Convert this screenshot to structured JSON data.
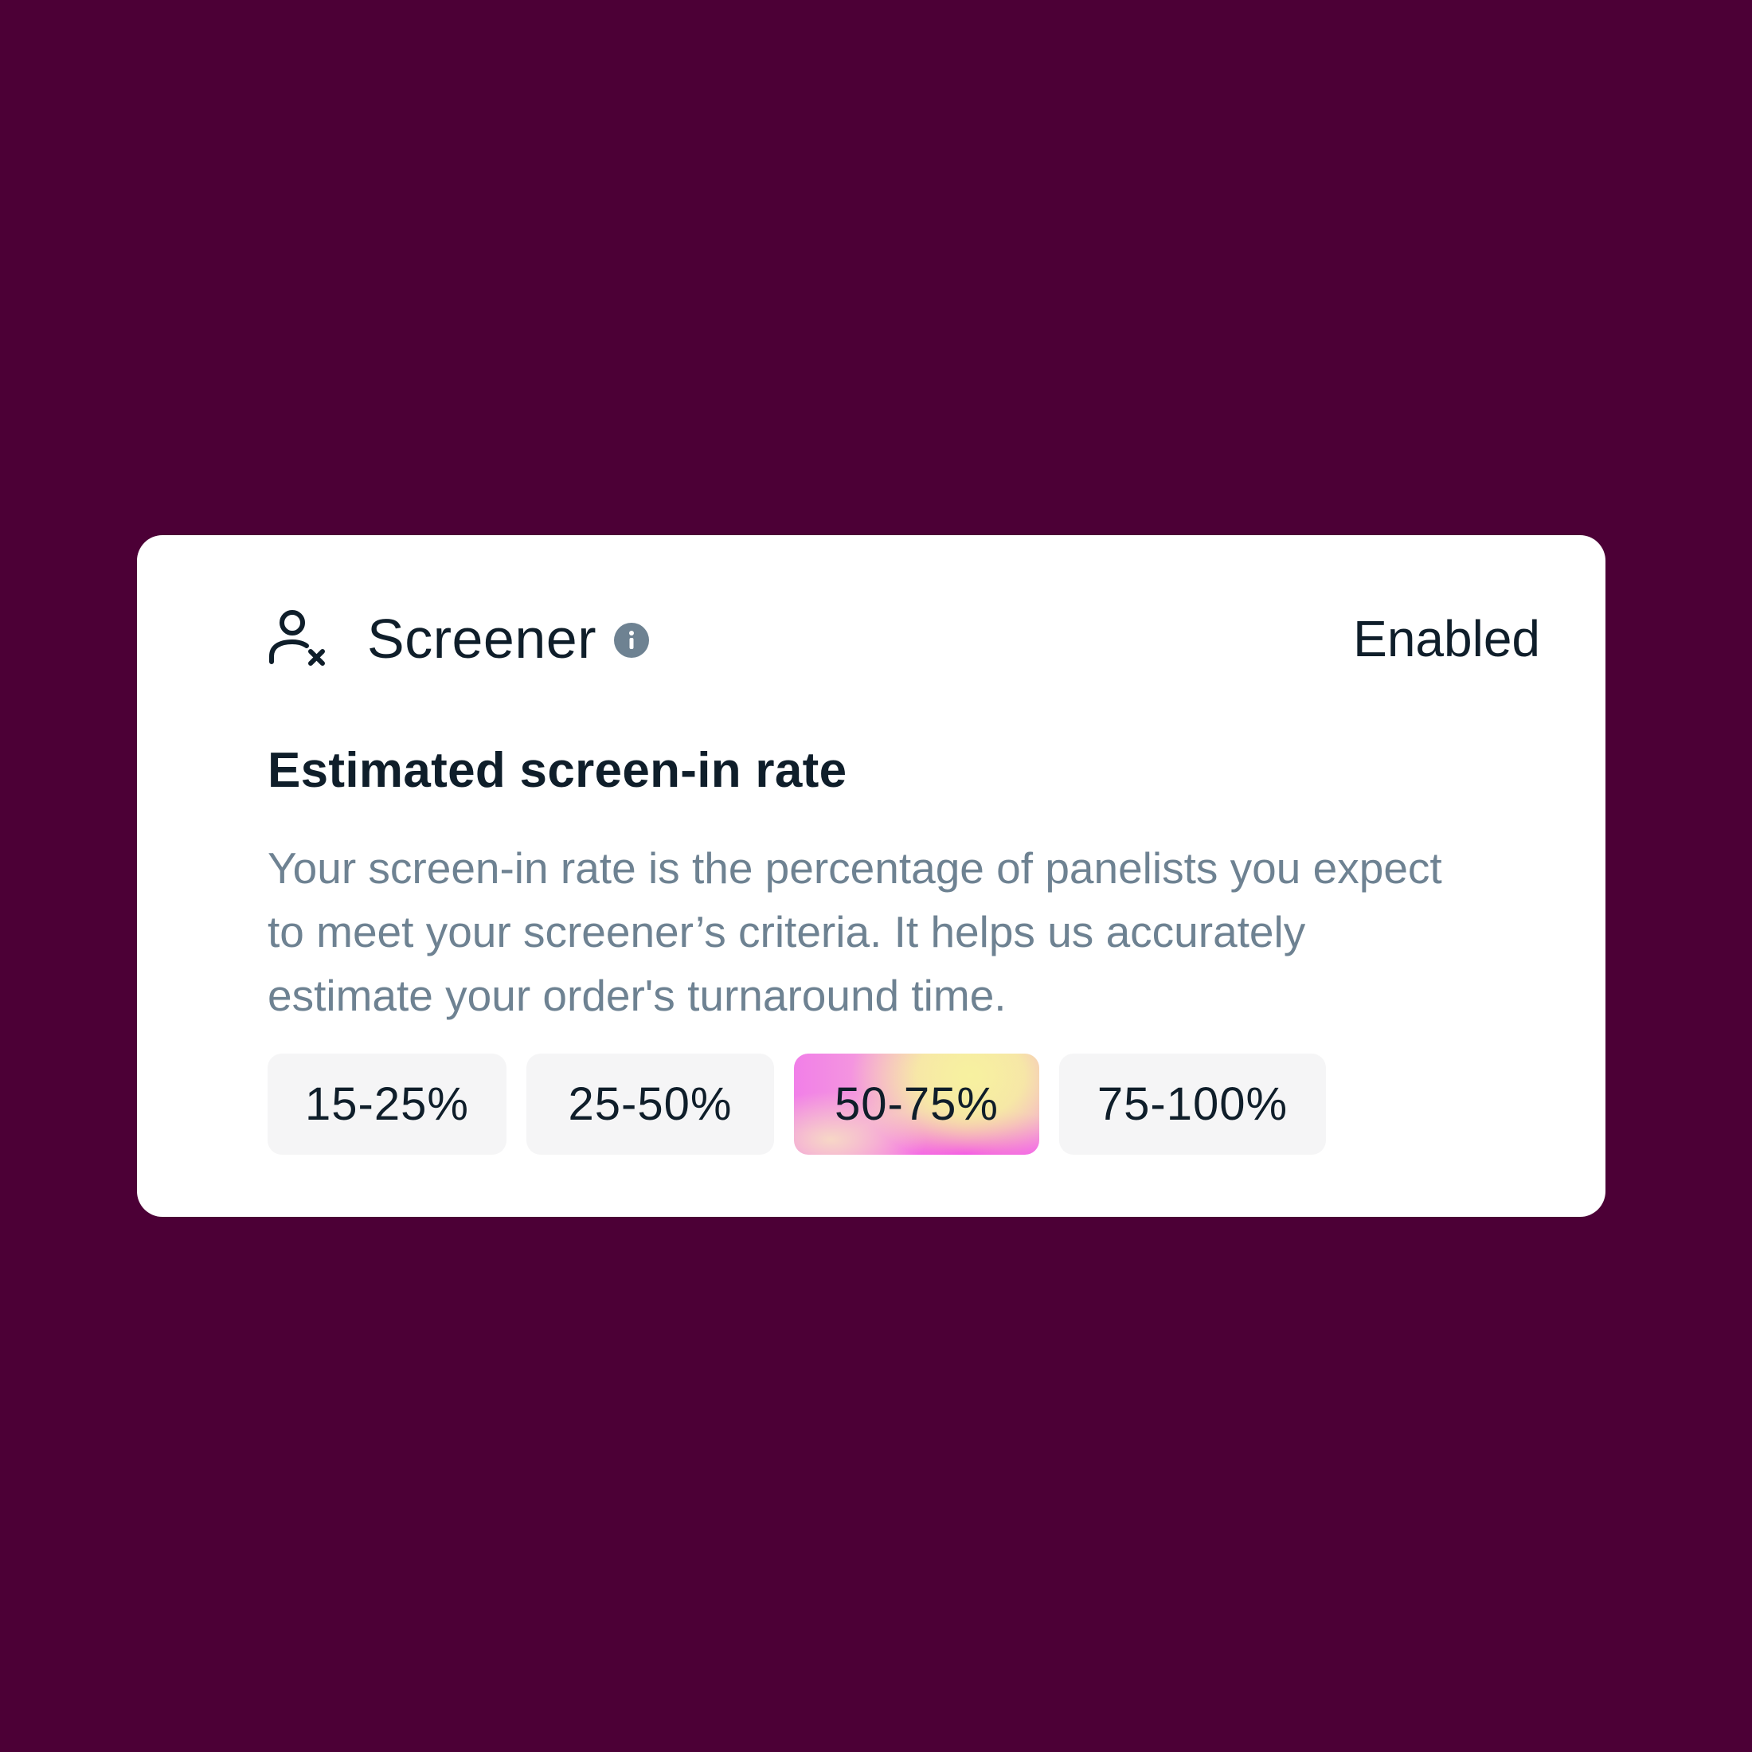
{
  "card": {
    "title": "Screener",
    "status": "Enabled",
    "icons": {
      "header": "user-x-icon",
      "info": "info-icon"
    },
    "subheading": "Estimated screen-in rate",
    "description": "Your screen-in rate is the percentage of panelists you expect to meet your screener’s criteria. It helps us accurately estimate your order's turnaround time.",
    "options": [
      {
        "label": "15-25%",
        "selected": false
      },
      {
        "label": "25-50%",
        "selected": false
      },
      {
        "label": "50-75%",
        "selected": true
      },
      {
        "label": "75-100%",
        "selected": false
      }
    ]
  },
  "colors": {
    "page_background": "#4c0036",
    "card_background": "#ffffff",
    "text_primary": "#0f1e2a",
    "text_secondary": "#6e8292",
    "option_background": "#f5f5f6",
    "selected_gradient": [
      "#f17fe8",
      "#f7f1a0",
      "#f43ff2"
    ]
  }
}
